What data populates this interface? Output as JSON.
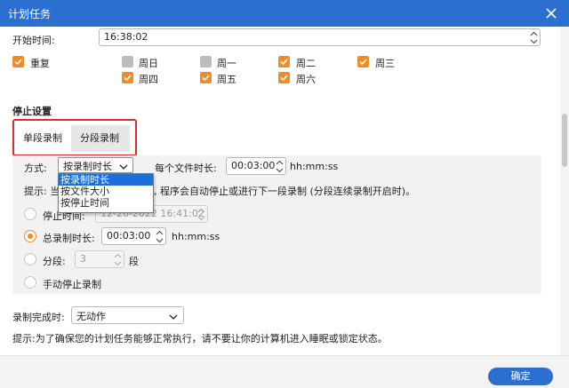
{
  "window": {
    "title": "计划任务"
  },
  "start": {
    "label": "开始时间:",
    "value": "16:38:02"
  },
  "repeat": {
    "label": "重复",
    "checked": true,
    "days": [
      {
        "label": "周日",
        "checked": false
      },
      {
        "label": "周一",
        "checked": false
      },
      {
        "label": "周二",
        "checked": true
      },
      {
        "label": "周三",
        "checked": true
      },
      {
        "label": "周四",
        "checked": true
      },
      {
        "label": "周五",
        "checked": true
      },
      {
        "label": "周六",
        "checked": true
      }
    ]
  },
  "stop": {
    "section_title": "停止设置",
    "tabs": [
      {
        "label": "单段录制",
        "active": true
      },
      {
        "label": "分段录制",
        "active": false
      }
    ],
    "mode_label": "方式:",
    "mode_value": "按录制时长",
    "mode_options": [
      "按录制时长",
      "按文件大小",
      "按停止时间"
    ],
    "per_file_label": "每个文件时长:",
    "per_file_value": "00:03:00",
    "per_file_unit": "hh:mm:ss",
    "hint_prefix": "提示: 当",
    "hint_suffix": ", 程序会自动停止或进行下一段录制 (分段连续录制开启时)。",
    "options": {
      "stop_time": {
        "label": "停止时间:",
        "value": "12-26-2022 16:41:02"
      },
      "total_duration": {
        "label": "总录制时长:",
        "value": "00:03:00",
        "unit": "hh:mm:ss",
        "selected": true
      },
      "segments": {
        "label": "分段:",
        "value": "3",
        "unit": "段"
      },
      "manual": {
        "label": "手动停止录制"
      }
    }
  },
  "after": {
    "label": "录制完成时:",
    "value": "无动作"
  },
  "tip": "提示:为了确保您的计划任务能够正常执行，请不要让你的计算机进入睡眠或锁定状态。",
  "footer": {
    "ok_label": "确定"
  },
  "colors": {
    "accent": "#2b6fd1",
    "check": "#f08b2a",
    "highlight_frame": "#e02b2b"
  }
}
